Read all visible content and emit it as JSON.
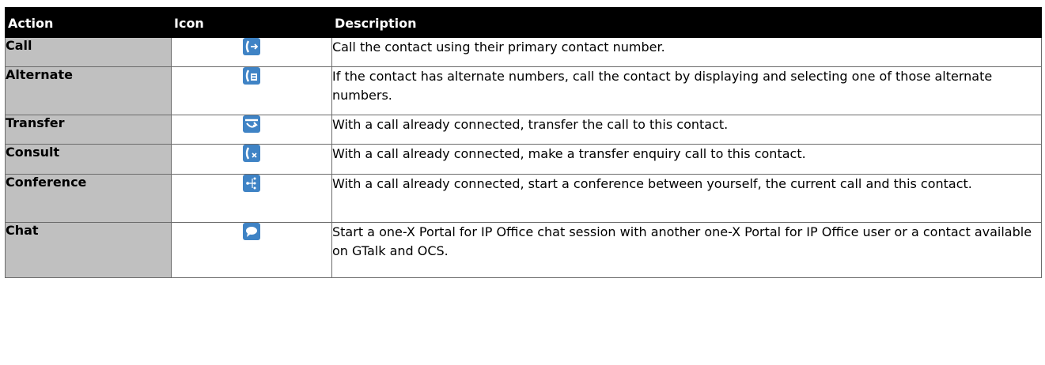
{
  "table": {
    "headers": {
      "action": "Action",
      "icon": "Icon",
      "description": "Description"
    },
    "rows": [
      {
        "action": "Call",
        "icon": "call-icon",
        "description": "Call the contact using their primary contact number."
      },
      {
        "action": "Alternate",
        "icon": "alternate-numbers-icon",
        "description": "If the contact has alternate numbers, call the contact by displaying and selecting one of those alternate numbers."
      },
      {
        "action": "Transfer",
        "icon": "transfer-icon",
        "description": "With a call already connected, transfer the call to this contact."
      },
      {
        "action": "Consult",
        "icon": "consult-icon",
        "description": "With a call already connected, make a transfer enquiry call to this contact."
      },
      {
        "action": "Conference",
        "icon": "conference-icon",
        "description": "With a call already connected, start a conference between yourself, the current call and this contact."
      },
      {
        "action": "Chat",
        "icon": "chat-icon",
        "description": "Start a one-X Portal for IP Office chat session with another one-X Portal for IP Office user or a contact available on GTalk and OCS."
      }
    ]
  },
  "colors": {
    "header_bg": "#000000",
    "action_bg": "#c0c0c0",
    "icon_bg": "#3f83c5"
  }
}
